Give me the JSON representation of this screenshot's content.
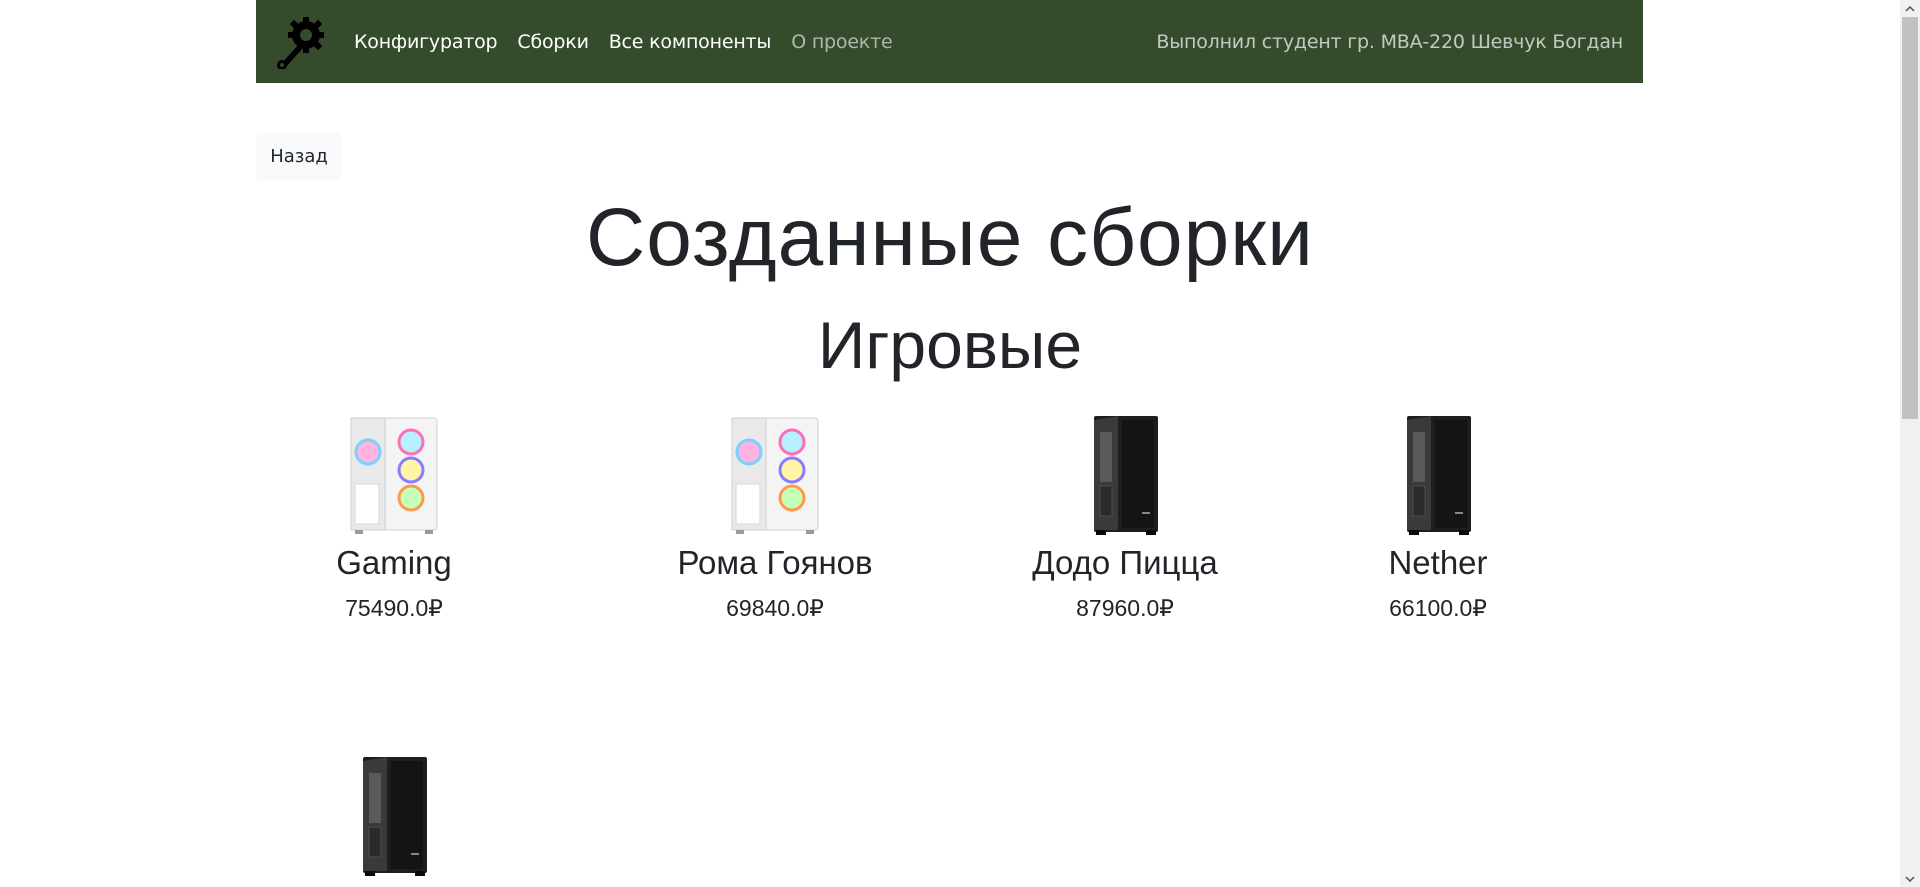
{
  "navbar": {
    "logo": "wrench-gear-logo",
    "links": [
      {
        "label": "Конфигуратор"
      },
      {
        "label": "Сборки"
      },
      {
        "label": "Все компоненты"
      },
      {
        "label": "О проекте"
      }
    ],
    "author": "Выполнил студент гр. МВА-220 Шевчук Богдан"
  },
  "back_button": {
    "label": "Назад"
  },
  "page_title": "Созданные сборки",
  "section_title": "Игровые",
  "builds": [
    {
      "name": "Gaming",
      "price": "75490.0₽",
      "case": "white-rgb-case"
    },
    {
      "name": "Рома Гоянов",
      "price": "69840.0₽",
      "case": "white-rgb-case"
    },
    {
      "name": "Додо Пицца",
      "price": "87960.0₽",
      "case": "black-glass-case"
    },
    {
      "name": "Nether",
      "price": "66100.0₽",
      "case": "black-glass-case"
    },
    {
      "name": "",
      "price": "",
      "case": "black-glass-case"
    }
  ],
  "colors": {
    "navbar_bg": "#344c2c",
    "text": "#212529",
    "button_bg": "#f8f9fa"
  }
}
